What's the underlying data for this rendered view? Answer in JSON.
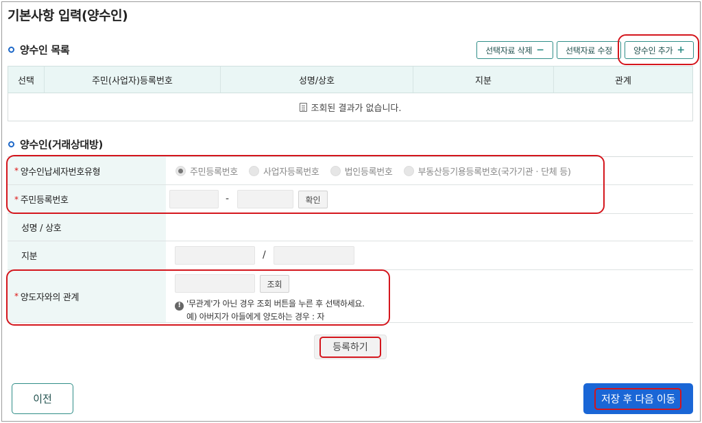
{
  "page": {
    "title": "기본사항 입력(양수인)"
  },
  "list_section": {
    "title": "양수인 목록",
    "buttons": {
      "delete": "선택자료 삭제",
      "edit": "선택자료 수정",
      "add": "양수인 추가"
    },
    "columns": [
      "선택",
      "주민(사업자)등록번호",
      "성명/상호",
      "지분",
      "관계"
    ],
    "empty_text": "조회된 결과가 없습니다."
  },
  "form_section": {
    "title": "양수인(거래상대방)",
    "type_row": {
      "label": "양수인납세자번호유형",
      "options": [
        "주민등록번호",
        "사업자등록번호",
        "법인등록번호",
        "부동산등기용등록번호(국가기관 · 단체 등)"
      ],
      "selected": "주민등록번호"
    },
    "id_row": {
      "label": "주민등록번호",
      "separator": "-",
      "confirm": "확인"
    },
    "name_row": {
      "label": "성명 / 상호"
    },
    "share_row": {
      "label": "지분",
      "separator": "/"
    },
    "relation_row": {
      "label": "양도자와의 관계",
      "search": "조회",
      "notice1": "'무관계'가 아닌 경우 조회 버튼을 누른 후 선택하세요.",
      "notice2": "예) 아버지가 아들에게 양도하는 경우 : 자"
    },
    "register": "등록하기"
  },
  "footer": {
    "prev": "이전",
    "next": "저장 후 다음 이동"
  },
  "colors": {
    "accent": "#2d8c86",
    "primary": "#1a66d6",
    "highlight": "#d4141b"
  }
}
